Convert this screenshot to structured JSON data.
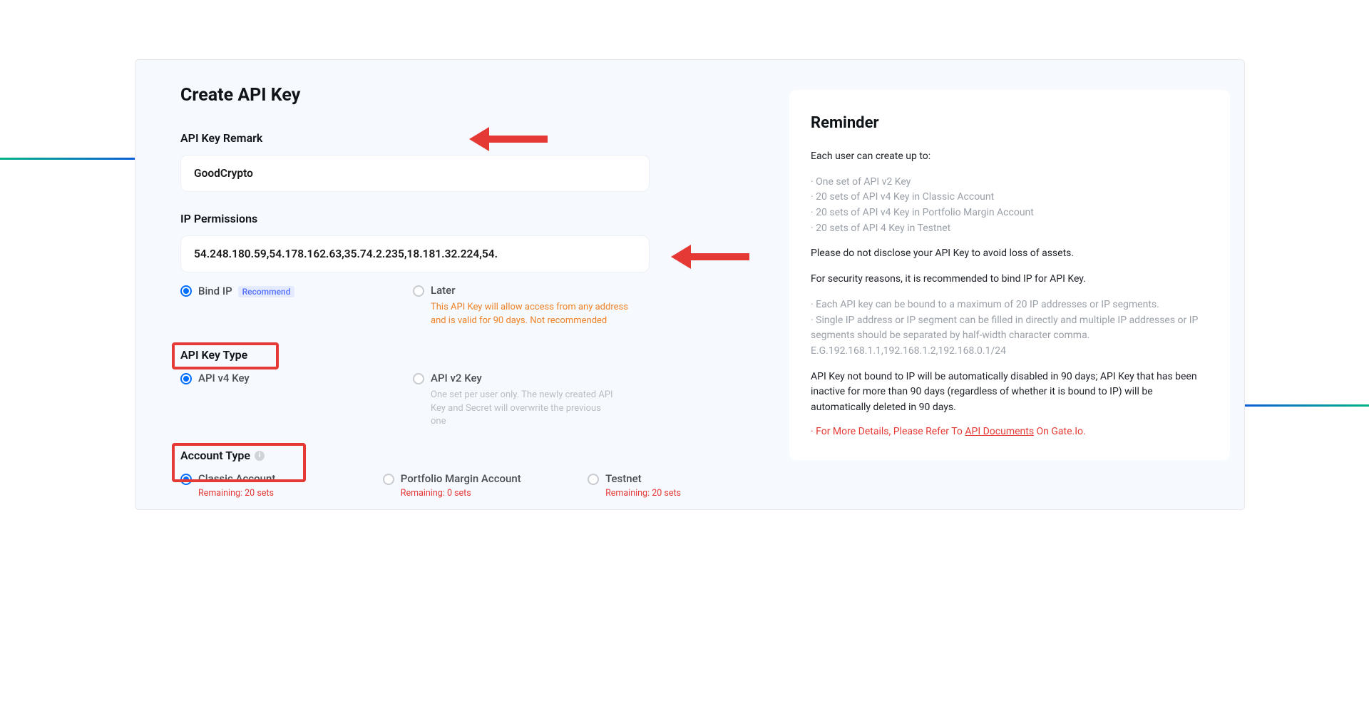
{
  "form": {
    "title": "Create API Key",
    "remark": {
      "label": "API Key Remark",
      "value": "GoodCrypto"
    },
    "ip": {
      "label": "IP Permissions",
      "value": "54.248.180.59,54.178.162.63,35.74.2.235,18.181.32.224,54.",
      "bind": {
        "label": "Bind IP",
        "badge": "Recommend"
      },
      "later": {
        "label": "Later",
        "note": "This API Key will allow access from any address and is valid for 90 days. Not recommended"
      }
    },
    "keytype": {
      "label": "API Key Type",
      "v4": {
        "label": "API v4 Key"
      },
      "v2": {
        "label": "API v2 Key",
        "note": "One set per user only. The newly created API Key and Secret will overwrite the previous one"
      }
    },
    "account": {
      "label": "Account Type",
      "remaining_label": "Remaining:",
      "sets": "sets",
      "classic": {
        "label": "Classic Account",
        "count": "20"
      },
      "portfolio": {
        "label": "Portfolio Margin Account",
        "count": "0"
      },
      "testnet": {
        "label": "Testnet",
        "count": "20"
      }
    }
  },
  "reminder": {
    "title": "Reminder",
    "p1": "Each user can create up to:",
    "list1": [
      "One set of API v2 Key",
      "20 sets of API v4 Key in Classic Account",
      "20 sets of API v4 Key in Portfolio Margin Account",
      "20 sets of API 4 Key in Testnet"
    ],
    "p2": "Please do not disclose your API Key to avoid loss of assets.",
    "p3": "For security reasons, it is recommended to bind IP for API Key.",
    "list2": [
      "Each API key can be bound to a maximum of 20 IP addresses or IP segments.",
      "Single IP address or IP segment can be filled in directly and multiple IP addresses or IP segments should be separated by half-width character comma. E.G.192.168.1.1,192.168.1.2,192.168.0.1/24"
    ],
    "p4": "API Key not bound to IP will be automatically disabled in 90 days; API Key that has been inactive for more than 90 days (regardless of whether it is bound to IP) will be automatically deleted in 90 days.",
    "more_pre": "For More Details, Please Refer To ",
    "more_link": "API Documents",
    "more_post": " On Gate.Io."
  }
}
